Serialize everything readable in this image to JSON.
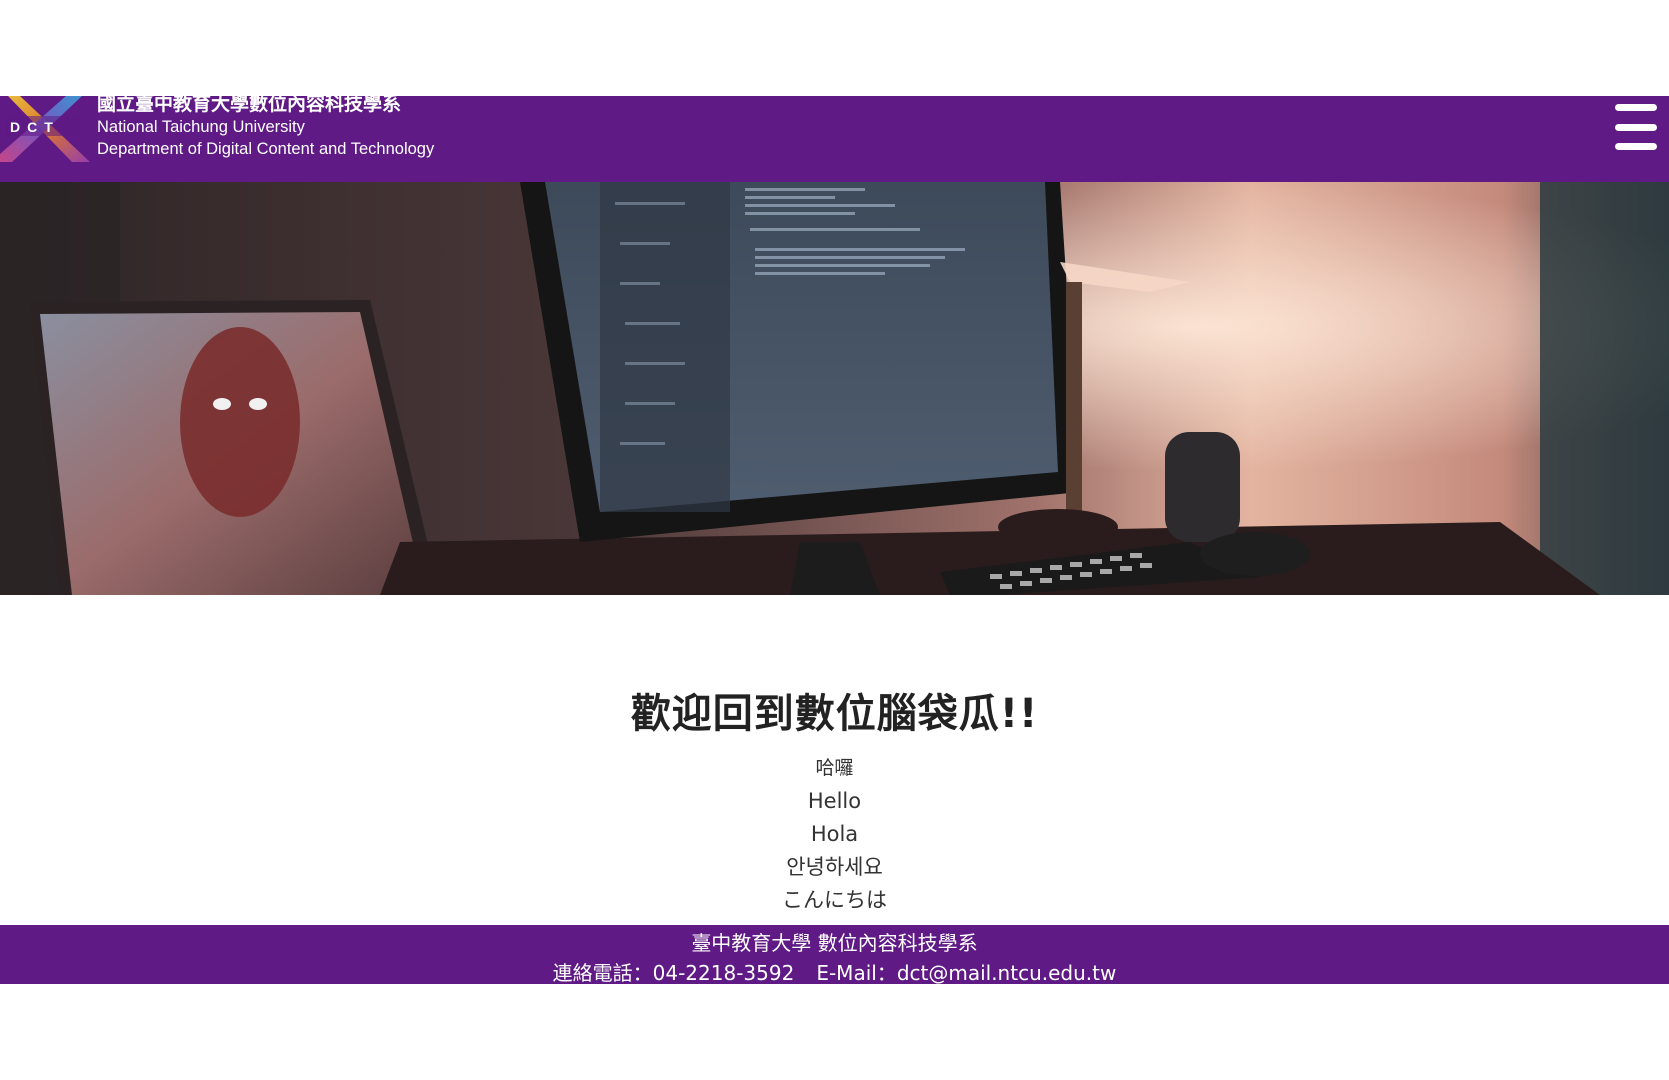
{
  "header": {
    "brand_line_1": "國立臺中教育大學數位內容科技學系",
    "brand_line_2": "National Taichung University",
    "brand_line_3": "Department of Digital Content and Technology",
    "logo_text": "DCT",
    "accent_color": "#5f1a85"
  },
  "hero": {
    "image_description_icon": "desk-computer-photo"
  },
  "welcome": {
    "title": "歡迎回到數位腦袋瓜!!",
    "greetings": [
      "哈囉",
      "Hello",
      "Hola",
      "안녕하세요",
      "こんにちは"
    ]
  },
  "footer": {
    "line_1": "臺中教育大學 數位內容科技學系",
    "phone_label": "連絡電話：",
    "phone": "04-2218-3592",
    "email_label": "E-Mail：",
    "email": "dct@mail.ntcu.edu.tw"
  }
}
